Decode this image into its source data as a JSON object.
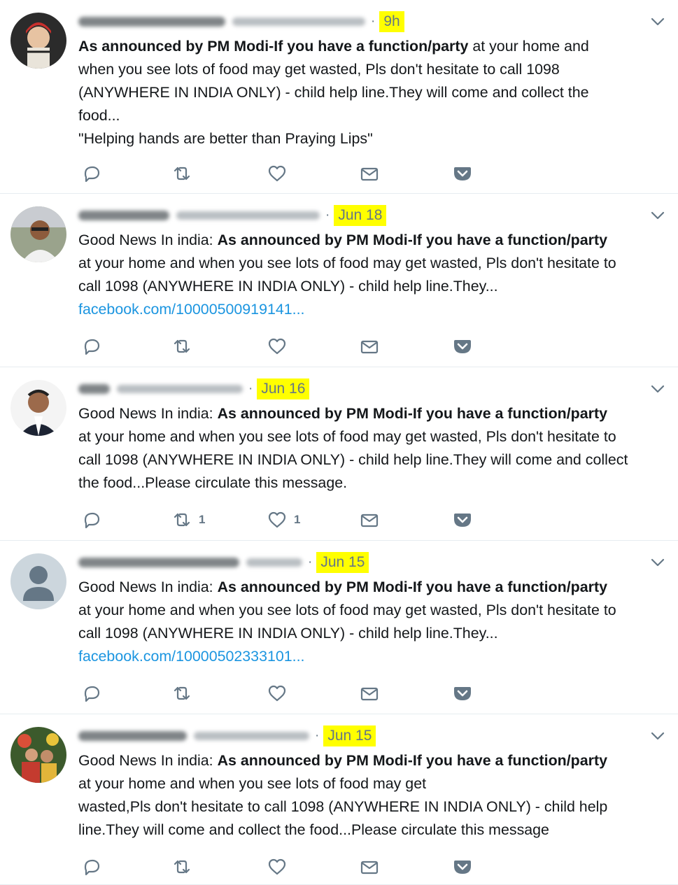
{
  "tweets": [
    {
      "time": "9h",
      "lines": [
        [
          {
            "b": true,
            "t": "As announced by PM Modi-If you have a function/party"
          },
          {
            "b": false,
            "t": " at your home and"
          }
        ],
        [
          {
            "b": false,
            "t": "when you see lots of food may get wasted, Pls don't hesitate to call 1098"
          }
        ],
        [
          {
            "b": false,
            "t": "(ANYWHERE IN INDIA ONLY) - child help line.They will come and collect the"
          }
        ],
        [
          {
            "b": false,
            "t": "food..."
          }
        ],
        [
          {
            "b": false,
            "t": "\"Helping hands are better than Praying Lips\""
          }
        ]
      ],
      "link": "",
      "retweets": "",
      "likes": ""
    },
    {
      "time": "Jun 18",
      "lines": [
        [
          {
            "b": false,
            "t": "Good News In india: "
          },
          {
            "b": true,
            "t": "As announced by PM Modi-If you have a function/party"
          }
        ],
        [
          {
            "b": false,
            "t": "at your home and when you see lots of food may get wasted, Pls don't hesitate to"
          }
        ],
        [
          {
            "b": false,
            "t": "call 1098 (ANYWHERE IN INDIA ONLY) - child help line.They..."
          }
        ]
      ],
      "link": "facebook.com/10000500919141...",
      "retweets": "",
      "likes": ""
    },
    {
      "time": "Jun 16",
      "lines": [
        [
          {
            "b": false,
            "t": "Good News In india: "
          },
          {
            "b": true,
            "t": "As announced by PM Modi-If you have a function/party"
          }
        ],
        [
          {
            "b": false,
            "t": "at your home and when you see lots of food may get wasted, Pls don't hesitate to"
          }
        ],
        [
          {
            "b": false,
            "t": "call 1098 (ANYWHERE IN INDIA ONLY) - child help line.They will come and collect"
          }
        ],
        [
          {
            "b": false,
            "t": "the food...Please circulate this message."
          }
        ]
      ],
      "link": "",
      "retweets": "1",
      "likes": "1"
    },
    {
      "time": "Jun 15",
      "lines": [
        [
          {
            "b": false,
            "t": "Good News In india: "
          },
          {
            "b": true,
            "t": "As announced by PM Modi-If you have a function/party"
          }
        ],
        [
          {
            "b": false,
            "t": "at your home and when you see lots of food may get wasted, Pls don't hesitate to"
          }
        ],
        [
          {
            "b": false,
            "t": "call 1098 (ANYWHERE IN INDIA ONLY) - child help line.They..."
          }
        ]
      ],
      "link": "facebook.com/10000502333101...",
      "retweets": "",
      "likes": ""
    },
    {
      "time": "Jun 15",
      "lines": [
        [
          {
            "b": false,
            "t": "Good News In india: "
          },
          {
            "b": true,
            "t": "As announced by PM Modi-If you have a function/party"
          }
        ],
        [
          {
            "b": false,
            "t": "at your home and when you see lots of food may get"
          }
        ],
        [
          {
            "b": false,
            "t": "wasted,Pls don't hesitate to call 1098 (ANYWHERE IN INDIA ONLY) - child help"
          }
        ],
        [
          {
            "b": false,
            "t": "line.They will come and collect the food...Please circulate this message"
          }
        ]
      ],
      "link": "",
      "retweets": "",
      "likes": ""
    }
  ],
  "colors": {
    "highlight": "#ffff00",
    "link": "#1b95e0",
    "muted": "#657786",
    "divider": "#e6ecf0"
  },
  "icons": [
    "reply-icon",
    "retweet-icon",
    "like-icon",
    "direct-message-icon",
    "pocket-save-icon",
    "chevron-down-icon"
  ]
}
